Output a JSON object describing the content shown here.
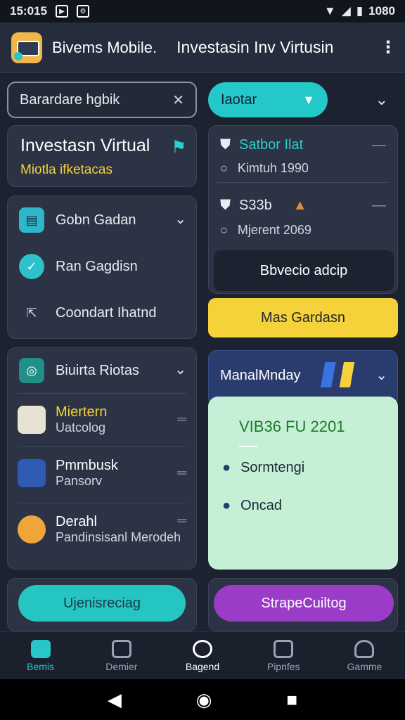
{
  "status": {
    "time": "15:015",
    "right_text": "1080"
  },
  "appbar": {
    "app_name": "Bivems Mobile.",
    "title": "Investasin Inv Virtusin"
  },
  "search": {
    "value": "Barardare hgbik"
  },
  "filter": {
    "label": "Iaotar"
  },
  "hero": {
    "title": "Investasn Virtual",
    "subtitle": "Miotla ifketacas"
  },
  "menu": [
    {
      "label": "Gobn Gadan"
    },
    {
      "label": "Ran Gagdisn"
    },
    {
      "label": "Coondart Ihatnd"
    }
  ],
  "info": [
    {
      "title": "Satbor Ilat",
      "sub": "Kimtuh 1990"
    },
    {
      "title": "S33b",
      "sub": "Mjerent 2069"
    }
  ],
  "buttons": {
    "dark": "Bbvecio adcip",
    "yellow": "Mas Gardasn",
    "teal_bottom": "Ujenisreciag",
    "purple_bottom": "StrapeCuiltog"
  },
  "list": {
    "header": "Biuirta Riotas",
    "items": [
      {
        "title": "Miertern",
        "sub": "Uatcolog"
      },
      {
        "title": "Pmmbusk",
        "sub": "Pansorv"
      },
      {
        "title": "Derahl",
        "sub": "Pandinsisanl Merodeh"
      }
    ]
  },
  "panel": {
    "title": "ManalMnday",
    "badge": "VIB36 FU 2201",
    "items": [
      "Sormtengi",
      "Oncad"
    ]
  },
  "nav": [
    {
      "label": "Bemis"
    },
    {
      "label": "Demier"
    },
    {
      "label": "Bagend"
    },
    {
      "label": "Pipnfes"
    },
    {
      "label": "Gamme"
    }
  ]
}
